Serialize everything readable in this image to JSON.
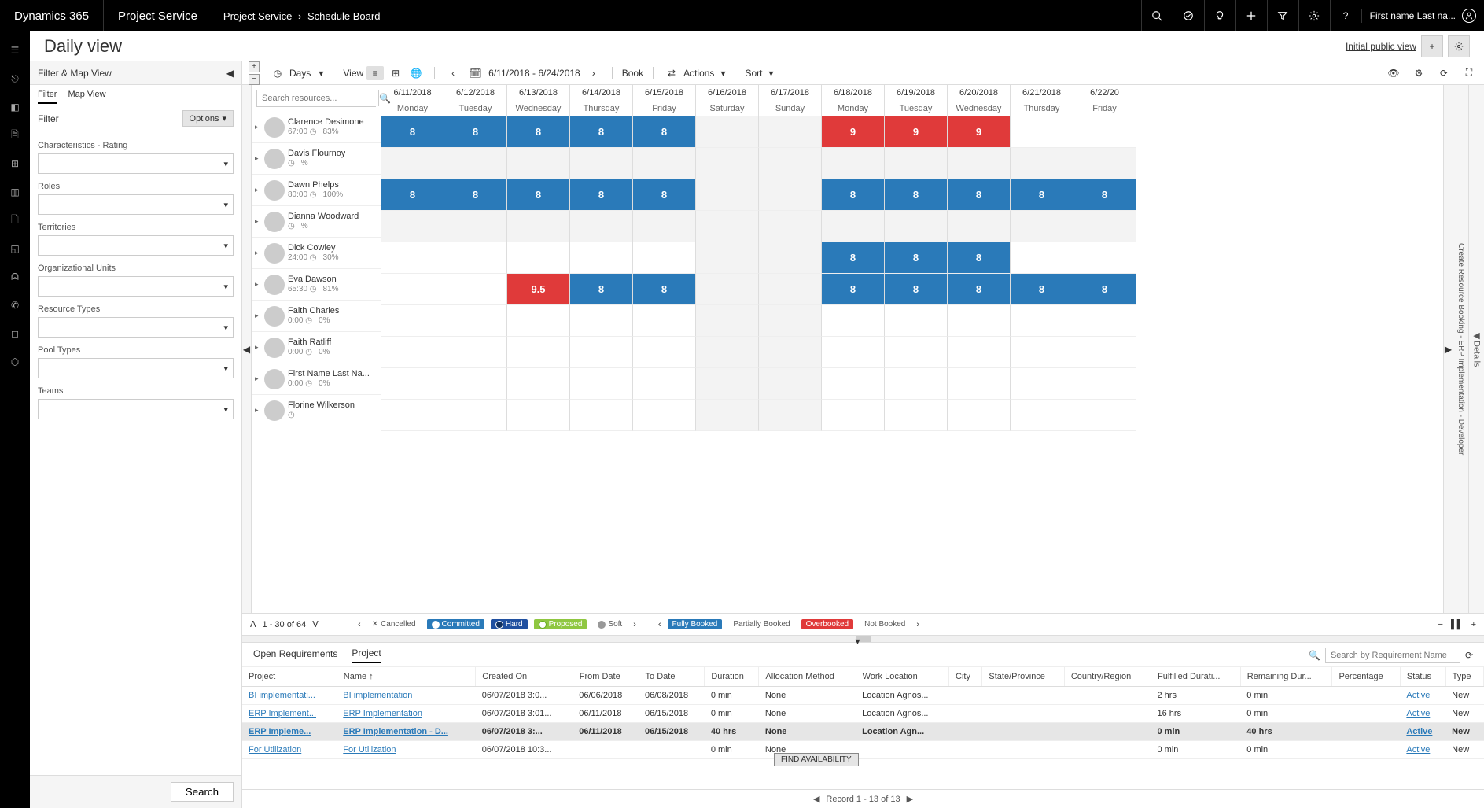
{
  "topbar": {
    "brand": "Dynamics 365",
    "module": "Project Service",
    "crumb1": "Project Service",
    "crumb2": "Schedule Board",
    "user_name": "First name Last na..."
  },
  "page": {
    "title": "Daily view",
    "view_link": "Initial public view"
  },
  "filter_panel": {
    "header": "Filter & Map View",
    "tab_filter": "Filter",
    "tab_map": "Map View",
    "sub_label": "Filter",
    "options_label": "Options",
    "fields": [
      "Characteristics - Rating",
      "Roles",
      "Territories",
      "Organizational Units",
      "Resource Types",
      "Pool Types",
      "Teams"
    ],
    "search_btn": "Search"
  },
  "stoolbar": {
    "days": "Days",
    "view": "View",
    "date_range": "6/11/2018 - 6/24/2018",
    "book": "Book",
    "actions": "Actions",
    "sort": "Sort"
  },
  "resources_search_placeholder": "Search resources...",
  "days": [
    {
      "date": "6/11/2018",
      "dow": "Monday"
    },
    {
      "date": "6/12/2018",
      "dow": "Tuesday"
    },
    {
      "date": "6/13/2018",
      "dow": "Wednesday"
    },
    {
      "date": "6/14/2018",
      "dow": "Thursday"
    },
    {
      "date": "6/15/2018",
      "dow": "Friday"
    },
    {
      "date": "6/16/2018",
      "dow": "Saturday"
    },
    {
      "date": "6/17/2018",
      "dow": "Sunday"
    },
    {
      "date": "6/18/2018",
      "dow": "Monday"
    },
    {
      "date": "6/19/2018",
      "dow": "Tuesday"
    },
    {
      "date": "6/20/2018",
      "dow": "Wednesday"
    },
    {
      "date": "6/21/2018",
      "dow": "Thursday"
    },
    {
      "date": "6/22/20",
      "dow": "Friday"
    }
  ],
  "resources": [
    {
      "name": "Clarence Desimone",
      "hours": "67:00",
      "pct": "83%",
      "cells": [
        {
          "v": "8",
          "c": "blue"
        },
        {
          "v": "8",
          "c": "blue"
        },
        {
          "v": "8",
          "c": "blue"
        },
        {
          "v": "8",
          "c": "blue"
        },
        {
          "v": "8",
          "c": "blue"
        },
        {
          "v": "",
          "c": "grey"
        },
        {
          "v": "",
          "c": "grey"
        },
        {
          "v": "9",
          "c": "red"
        },
        {
          "v": "9",
          "c": "red"
        },
        {
          "v": "9",
          "c": "red"
        },
        {
          "v": "",
          "c": "empty"
        },
        {
          "v": "",
          "c": "empty"
        }
      ]
    },
    {
      "name": "Davis Flournoy",
      "hours": "",
      "pct": "%",
      "cells": [
        {
          "v": "",
          "c": "grey"
        },
        {
          "v": "",
          "c": "grey"
        },
        {
          "v": "",
          "c": "grey"
        },
        {
          "v": "",
          "c": "grey"
        },
        {
          "v": "",
          "c": "grey"
        },
        {
          "v": "",
          "c": "grey"
        },
        {
          "v": "",
          "c": "grey"
        },
        {
          "v": "",
          "c": "grey"
        },
        {
          "v": "",
          "c": "grey"
        },
        {
          "v": "",
          "c": "grey"
        },
        {
          "v": "",
          "c": "grey"
        },
        {
          "v": "",
          "c": "grey"
        }
      ]
    },
    {
      "name": "Dawn Phelps",
      "hours": "80:00",
      "pct": "100%",
      "cells": [
        {
          "v": "8",
          "c": "blue"
        },
        {
          "v": "8",
          "c": "blue"
        },
        {
          "v": "8",
          "c": "blue"
        },
        {
          "v": "8",
          "c": "blue"
        },
        {
          "v": "8",
          "c": "blue"
        },
        {
          "v": "",
          "c": "grey"
        },
        {
          "v": "",
          "c": "grey"
        },
        {
          "v": "8",
          "c": "blue"
        },
        {
          "v": "8",
          "c": "blue"
        },
        {
          "v": "8",
          "c": "blue"
        },
        {
          "v": "8",
          "c": "blue"
        },
        {
          "v": "8",
          "c": "blue"
        }
      ]
    },
    {
      "name": "Dianna Woodward",
      "hours": "",
      "pct": "%",
      "cells": [
        {
          "v": "",
          "c": "grey"
        },
        {
          "v": "",
          "c": "grey"
        },
        {
          "v": "",
          "c": "grey"
        },
        {
          "v": "",
          "c": "grey"
        },
        {
          "v": "",
          "c": "grey"
        },
        {
          "v": "",
          "c": "grey"
        },
        {
          "v": "",
          "c": "grey"
        },
        {
          "v": "",
          "c": "grey"
        },
        {
          "v": "",
          "c": "grey"
        },
        {
          "v": "",
          "c": "grey"
        },
        {
          "v": "",
          "c": "grey"
        },
        {
          "v": "",
          "c": "grey"
        }
      ]
    },
    {
      "name": "Dick Cowley",
      "hours": "24:00",
      "pct": "30%",
      "cells": [
        {
          "v": "",
          "c": "empty"
        },
        {
          "v": "",
          "c": "empty"
        },
        {
          "v": "",
          "c": "empty"
        },
        {
          "v": "",
          "c": "empty"
        },
        {
          "v": "",
          "c": "empty"
        },
        {
          "v": "",
          "c": "grey"
        },
        {
          "v": "",
          "c": "grey"
        },
        {
          "v": "8",
          "c": "blue"
        },
        {
          "v": "8",
          "c": "blue"
        },
        {
          "v": "8",
          "c": "blue"
        },
        {
          "v": "",
          "c": "empty"
        },
        {
          "v": "",
          "c": "empty"
        }
      ]
    },
    {
      "name": "Eva Dawson",
      "hours": "65:30",
      "pct": "81%",
      "cells": [
        {
          "v": "",
          "c": "empty"
        },
        {
          "v": "",
          "c": "empty"
        },
        {
          "v": "9.5",
          "c": "red"
        },
        {
          "v": "8",
          "c": "blue"
        },
        {
          "v": "8",
          "c": "blue"
        },
        {
          "v": "",
          "c": "grey"
        },
        {
          "v": "",
          "c": "grey"
        },
        {
          "v": "8",
          "c": "blue"
        },
        {
          "v": "8",
          "c": "blue"
        },
        {
          "v": "8",
          "c": "blue"
        },
        {
          "v": "8",
          "c": "blue"
        },
        {
          "v": "8",
          "c": "blue"
        }
      ]
    },
    {
      "name": "Faith Charles",
      "hours": "0:00",
      "pct": "0%",
      "cells": [
        {
          "v": "",
          "c": "empty"
        },
        {
          "v": "",
          "c": "empty"
        },
        {
          "v": "",
          "c": "empty"
        },
        {
          "v": "",
          "c": "empty"
        },
        {
          "v": "",
          "c": "empty"
        },
        {
          "v": "",
          "c": "grey"
        },
        {
          "v": "",
          "c": "grey"
        },
        {
          "v": "",
          "c": "empty"
        },
        {
          "v": "",
          "c": "empty"
        },
        {
          "v": "",
          "c": "empty"
        },
        {
          "v": "",
          "c": "empty"
        },
        {
          "v": "",
          "c": "empty"
        }
      ]
    },
    {
      "name": "Faith Ratliff",
      "hours": "0:00",
      "pct": "0%",
      "cells": [
        {
          "v": "",
          "c": "empty"
        },
        {
          "v": "",
          "c": "empty"
        },
        {
          "v": "",
          "c": "empty"
        },
        {
          "v": "",
          "c": "empty"
        },
        {
          "v": "",
          "c": "empty"
        },
        {
          "v": "",
          "c": "grey"
        },
        {
          "v": "",
          "c": "grey"
        },
        {
          "v": "",
          "c": "empty"
        },
        {
          "v": "",
          "c": "empty"
        },
        {
          "v": "",
          "c": "empty"
        },
        {
          "v": "",
          "c": "empty"
        },
        {
          "v": "",
          "c": "empty"
        }
      ]
    },
    {
      "name": "First Name Last Na...",
      "hours": "0:00",
      "pct": "0%",
      "cells": [
        {
          "v": "",
          "c": "empty"
        },
        {
          "v": "",
          "c": "empty"
        },
        {
          "v": "",
          "c": "empty"
        },
        {
          "v": "",
          "c": "empty"
        },
        {
          "v": "",
          "c": "empty"
        },
        {
          "v": "",
          "c": "grey"
        },
        {
          "v": "",
          "c": "grey"
        },
        {
          "v": "",
          "c": "empty"
        },
        {
          "v": "",
          "c": "empty"
        },
        {
          "v": "",
          "c": "empty"
        },
        {
          "v": "",
          "c": "empty"
        },
        {
          "v": "",
          "c": "empty"
        }
      ]
    },
    {
      "name": "Florine Wilkerson",
      "hours": "",
      "pct": "",
      "cells": [
        {
          "v": "",
          "c": "empty"
        },
        {
          "v": "",
          "c": "empty"
        },
        {
          "v": "",
          "c": "empty"
        },
        {
          "v": "",
          "c": "empty"
        },
        {
          "v": "",
          "c": "empty"
        },
        {
          "v": "",
          "c": "grey"
        },
        {
          "v": "",
          "c": "grey"
        },
        {
          "v": "",
          "c": "empty"
        },
        {
          "v": "",
          "c": "empty"
        },
        {
          "v": "",
          "c": "empty"
        },
        {
          "v": "",
          "c": "empty"
        },
        {
          "v": "",
          "c": "empty"
        }
      ]
    }
  ],
  "pager": {
    "text": "1 - 30 of 64"
  },
  "legend": {
    "cancelled": "Cancelled",
    "committed": "Committed",
    "hard": "Hard",
    "proposed": "Proposed",
    "soft": "Soft",
    "fully": "Fully Booked",
    "partially": "Partially Booked",
    "over": "Overbooked",
    "not": "Not Booked"
  },
  "right_panel": {
    "details": "Details",
    "create": "Create Resource Booking - ERP Implementation - Developer"
  },
  "bottom": {
    "tab_open": "Open Requirements",
    "tab_project": "Project",
    "search_placeholder": "Search by Requirement Name",
    "find_btn": "FIND AVAILABILITY",
    "headers": [
      "Project",
      "Name ↑",
      "Created On",
      "From Date",
      "To Date",
      "Duration",
      "Allocation Method",
      "Work Location",
      "City",
      "State/Province",
      "Country/Region",
      "Fulfilled Durati...",
      "Remaining Dur...",
      "Percentage",
      "Status",
      "Type"
    ],
    "rows": [
      {
        "selected": false,
        "project": "BI implementati...",
        "name": "BI implementation",
        "created": "06/07/2018 3:0...",
        "from": "06/06/2018",
        "to": "06/08/2018",
        "dur": "0 min",
        "alloc": "None",
        "loc": "Location Agnos...",
        "city": "",
        "state": "",
        "country": "",
        "fulfilled": "2 hrs",
        "remain": "0 min",
        "pct": "",
        "status": "Active",
        "type": "New"
      },
      {
        "selected": false,
        "project": "ERP Implement...",
        "name": "ERP Implementation",
        "created": "06/07/2018 3:01...",
        "from": "06/11/2018",
        "to": "06/15/2018",
        "dur": "0 min",
        "alloc": "None",
        "loc": "Location Agnos...",
        "city": "",
        "state": "",
        "country": "",
        "fulfilled": "16 hrs",
        "remain": "0 min",
        "pct": "",
        "status": "Active",
        "type": "New"
      },
      {
        "selected": true,
        "project": "ERP Impleme...",
        "name": "ERP Implementation - D...",
        "created": "06/07/2018 3:...",
        "from": "06/11/2018",
        "to": "06/15/2018",
        "dur": "40 hrs",
        "alloc": "None",
        "loc": "Location Agn...",
        "city": "",
        "state": "",
        "country": "",
        "fulfilled": "0 min",
        "remain": "40 hrs",
        "pct": "",
        "status": "Active",
        "type": "New"
      },
      {
        "selected": false,
        "project": "For Utilization",
        "name": "For Utilization",
        "created": "06/07/2018 10:3...",
        "from": "",
        "to": "",
        "dur": "0 min",
        "alloc": "None",
        "loc": "",
        "city": "",
        "state": "",
        "country": "",
        "fulfilled": "0 min",
        "remain": "0 min",
        "pct": "",
        "status": "Active",
        "type": "New"
      }
    ],
    "footer_text": "Record 1 - 13 of 13"
  }
}
